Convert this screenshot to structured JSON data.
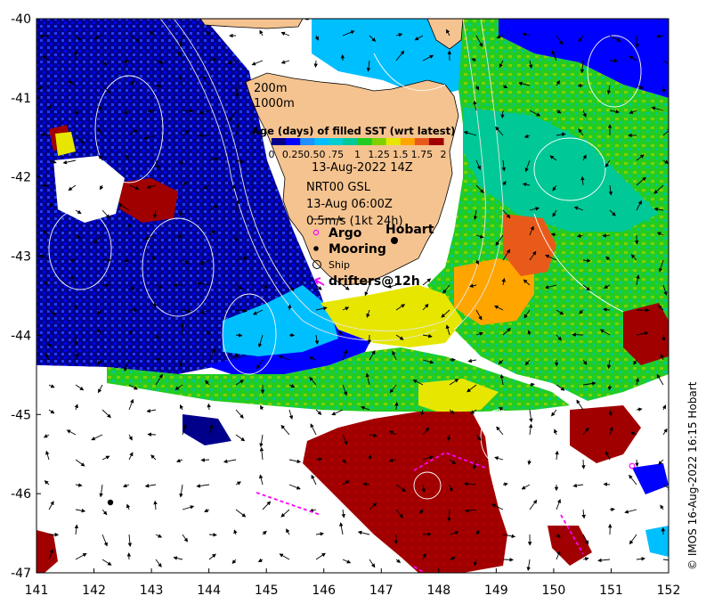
{
  "map": {
    "colorbar_title": "Age (days) of filled SST (wrt latest)",
    "colorbar_ticks": [
      "0",
      "0.25",
      "0.50",
      ".75",
      "1",
      "1.25",
      "1.5",
      "1.75",
      "2"
    ],
    "colorbar_colors": [
      "#00008b",
      "#0000ff",
      "#1e90ff",
      "#00bfff",
      "#00ced1",
      "#00c896",
      "#22cc22",
      "#7fd000",
      "#e6e600",
      "#ffa500",
      "#e85a1a",
      "#a00000"
    ],
    "image_time": "13-Aug-2022 14Z",
    "model_label": "NRT00 GSL",
    "model_time": "13-Aug 06:00Z",
    "arrow_scale": "0.5m/s (1kt 24h)",
    "contours": [
      "200m",
      "1000m"
    ],
    "legend": [
      {
        "label": "Argo",
        "symbol": "ring",
        "color": "#ff00ff"
      },
      {
        "label": "Mooring",
        "symbol": "dot",
        "color": "#000000"
      },
      {
        "label": "Ship",
        "symbol": "circle",
        "color": "#000000"
      },
      {
        "label": "drifters@12h",
        "symbol": "arrow",
        "color": "#ff00ff"
      }
    ],
    "place_label": "Hobart",
    "x_ticks": [
      "141",
      "142",
      "143",
      "144",
      "145",
      "146",
      "147",
      "148",
      "149",
      "150",
      "151",
      "152"
    ],
    "y_ticks": [
      "-40",
      "-41",
      "-42",
      "-43",
      "-44",
      "-45",
      "-46",
      "-47"
    ],
    "lon_range": [
      141,
      152
    ],
    "lat_range": [
      -47,
      -40
    ],
    "credit": "© IMOS 16-Aug-2022 16:15 Hobart",
    "colors": {
      "land": "#f5c38f",
      "deep_blue": "#00008b",
      "blue": "#0000ff",
      "cyan": "#00bfff",
      "green": "#22cc22",
      "sea_green": "#00c896",
      "yellow": "#e6e600",
      "orange": "#ffa500",
      "red": "#a00000",
      "argo": "#ff00ff"
    }
  }
}
